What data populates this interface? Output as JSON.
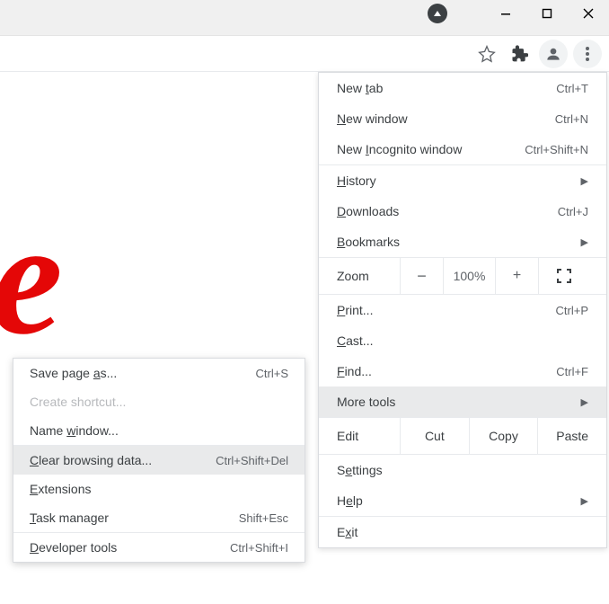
{
  "titlebar": {
    "close": "✕",
    "maximize": "□",
    "minimize": "—"
  },
  "menu": {
    "new_tab": {
      "prefix": "New ",
      "u": "t",
      "suffix": "ab",
      "short": "Ctrl+T"
    },
    "new_window": {
      "prefix": "",
      "u": "N",
      "suffix": "ew window",
      "short": "Ctrl+N"
    },
    "new_incognito": {
      "prefix": "New ",
      "u": "I",
      "suffix": "ncognito window",
      "short": "Ctrl+Shift+N"
    },
    "history": {
      "prefix": "",
      "u": "H",
      "suffix": "istory"
    },
    "downloads": {
      "prefix": "",
      "u": "D",
      "suffix": "ownloads",
      "short": "Ctrl+J"
    },
    "bookmarks": {
      "prefix": "",
      "u": "B",
      "suffix": "ookmarks"
    },
    "zoom_label": "Zoom",
    "zoom_minus": "−",
    "zoom_value": "100%",
    "zoom_plus": "+",
    "print": {
      "prefix": "",
      "u": "P",
      "suffix": "rint...",
      "short": "Ctrl+P"
    },
    "cast": {
      "prefix": "",
      "u": "C",
      "suffix": "ast..."
    },
    "find": {
      "prefix": "",
      "u": "F",
      "suffix": "ind...",
      "short": "Ctrl+F"
    },
    "more_tools": {
      "label": "More tools"
    },
    "edit_label": "Edit",
    "cut": "Cut",
    "copy": "Copy",
    "paste": "Paste",
    "settings": {
      "prefix": "S",
      "u": "e",
      "suffix": "ttings"
    },
    "help": {
      "prefix": "H",
      "u": "e",
      "suffix": "lp"
    },
    "exit": {
      "prefix": "E",
      "u": "x",
      "suffix": "it"
    }
  },
  "submenu": {
    "save_page": {
      "prefix": "Save page ",
      "u": "a",
      "suffix": "s...",
      "short": "Ctrl+S"
    },
    "create_shortcut": {
      "label": "Create shortcut..."
    },
    "name_window": {
      "prefix": "Name ",
      "u": "w",
      "suffix": "indow..."
    },
    "clear_data": {
      "prefix": "",
      "u": "C",
      "suffix": "lear browsing data...",
      "short": "Ctrl+Shift+Del"
    },
    "extensions": {
      "prefix": "",
      "u": "E",
      "suffix": "xtensions"
    },
    "task_manager": {
      "prefix": "",
      "u": "T",
      "suffix": "ask manager",
      "short": "Shift+Esc"
    },
    "dev_tools": {
      "prefix": "",
      "u": "D",
      "suffix": "eveloper tools",
      "short": "Ctrl+Shift+I"
    }
  }
}
